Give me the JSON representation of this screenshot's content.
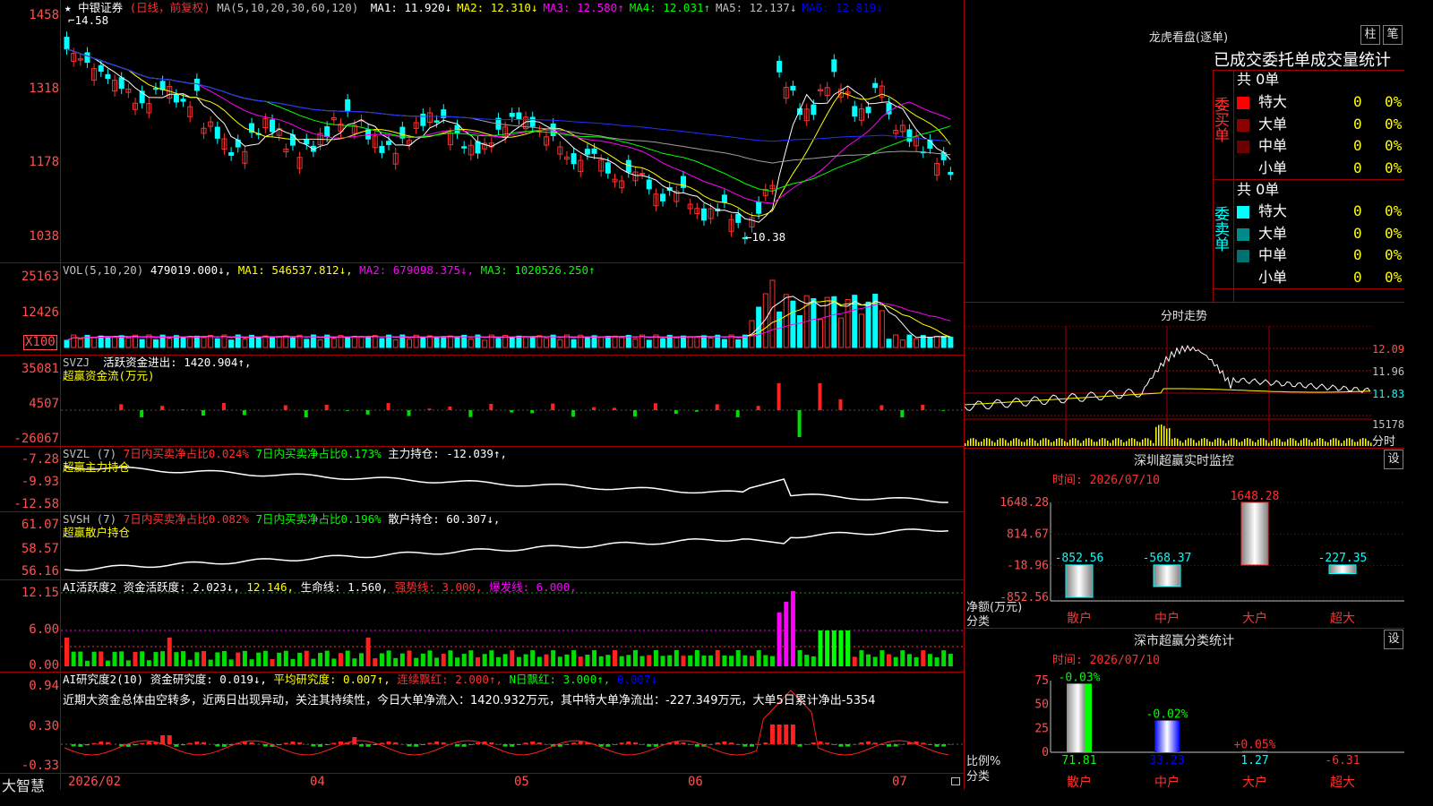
{
  "stock": {
    "name": "中银证券",
    "period": "(日线，前复权)",
    "ma_params": "MA(5,10,20,30,60,120)",
    "ma": [
      {
        "label": "MA1:",
        "value": "11.920",
        "arrow": "↓",
        "color": "#ffffff"
      },
      {
        "label": "MA2:",
        "value": "12.310",
        "arrow": "↓",
        "color": "#ffff00"
      },
      {
        "label": "MA3:",
        "value": "12.580",
        "arrow": "↑",
        "color": "#ff00ff"
      },
      {
        "label": "MA4:",
        "value": "12.031",
        "arrow": "↑",
        "color": "#00ff00"
      },
      {
        "label": "MA5:",
        "value": "12.137",
        "arrow": "↓",
        "color": "#c0c0c0"
      },
      {
        "label": "MA6:",
        "value": "12.819",
        "arrow": "↓",
        "color": "#0000ff"
      }
    ],
    "y_labels": [
      "1458",
      "1318",
      "1178",
      "1038"
    ],
    "high_label": "14.58",
    "low_label": "10.38"
  },
  "vol": {
    "params": "VOL(5,10,20)",
    "value": "479019.000↓,",
    "ma1": "MA1: 546537.812↓,",
    "ma2": "MA2: 679098.375↓,",
    "ma3": "MA3: 1020526.250↑",
    "y_labels": [
      "25163",
      "12426"
    ],
    "unit": "X100"
  },
  "svzj": {
    "name": "SVZJ",
    "desc": "活跃资金进出: 1420.904↑,",
    "sub": "超赢资金流(万元)",
    "y_labels": [
      "35081",
      "4507",
      "-26067"
    ]
  },
  "svzl": {
    "name": "SVZL (7)",
    "a": "7日内买卖净占比0.024%",
    "b": "7日内买卖净占比0.173%",
    "c": "主力持仓: -12.039↑,",
    "sub": "超赢主力持仓",
    "y_labels": [
      "-7.28",
      "-9.93",
      "-12.58"
    ]
  },
  "svsh": {
    "name": "SVSH (7)",
    "a": "7日内买卖净占比0.082%",
    "b": "7日内买卖净占比0.196%",
    "c": "散户持仓: 60.307↓,",
    "sub": "超赢散户持仓",
    "y_labels": [
      "61.07",
      "58.57",
      "56.16"
    ]
  },
  "ai_act": {
    "name": "AI活跃度2",
    "a": "资金活跃度: 2.023↓,",
    "b": "12.146,",
    "c": "生命线: 1.560,",
    "d": "强势线: 3.000,",
    "e": "爆发线: 6.000,",
    "y_labels": [
      "12.15",
      "6.00",
      "0.00"
    ]
  },
  "ai_res": {
    "name": "AI研究度2(10)",
    "a": "资金研究度: 0.019↓,",
    "b": "平均研究度: 0.007↑,",
    "c": "连续飘红: 2.000↑,",
    "d": "N日飘红: 3.000↑,",
    "e": "0.007↓",
    "comment": "近期大资金总体由空转多，近两日出现异动，关注其持续性，今日大单净流入：1420.932万元，其中特大单净流出：-227.349万元，大单5日累计净出-5354",
    "y_labels": [
      "0.94",
      "0.30",
      "-0.33"
    ]
  },
  "x_axis": {
    "app_name": "大智慧",
    "labels": [
      "2026/02",
      "04",
      "05",
      "06",
      "07"
    ]
  },
  "dragon": {
    "title": "龙虎看盘(逐单)",
    "btn1": "柱",
    "btn2": "笔",
    "header": "已成交委托单成交量统计",
    "buy_label": "委买单",
    "sell_label": "委卖单",
    "buy_total": "共 0单",
    "sell_total": "共 0单",
    "buy_rows": [
      {
        "name": "特大",
        "count": "0",
        "pct": "0%",
        "color": "#ff0000"
      },
      {
        "name": "大单",
        "count": "0",
        "pct": "0%",
        "color": "#8b0000"
      },
      {
        "name": "中单",
        "count": "0",
        "pct": "0%",
        "color": "#6b0000"
      },
      {
        "name": "小单",
        "count": "0",
        "pct": "0%",
        "color": ""
      }
    ],
    "sell_rows": [
      {
        "name": "特大",
        "count": "0",
        "pct": "0%",
        "color": "#00ffff"
      },
      {
        "name": "大单",
        "count": "0",
        "pct": "0%",
        "color": "#008b8b"
      },
      {
        "name": "中单",
        "count": "0",
        "pct": "0%",
        "color": "#007070"
      },
      {
        "name": "小单",
        "count": "0",
        "pct": "0%",
        "color": ""
      }
    ]
  },
  "minute": {
    "title": "分时走势",
    "labels": [
      "12.09",
      "11.96",
      "11.83",
      "15178"
    ],
    "unit": "分时"
  },
  "sz_monitor": {
    "title": "深圳超赢实时监控",
    "btn": "设",
    "time": "时间: 2026/07/10",
    "y_labels": [
      "1648.28",
      "814.67",
      "-18.96",
      "-852.56"
    ],
    "axis_title": "净额(万元)",
    "axis_sub": "分类",
    "categories": [
      "散户",
      "中户",
      "大户",
      "超大"
    ],
    "values": [
      -852.56,
      -568.37,
      1648.28,
      -227.35
    ],
    "value_labels": [
      "-852.56",
      "-568.37",
      "1648.28",
      "-227.35"
    ]
  },
  "sz_class": {
    "title": "深市超赢分类统计",
    "btn": "设",
    "time": "时间: 2026/07/10",
    "y_labels": [
      "75",
      "50",
      "25",
      "0"
    ],
    "axis_title": "比例%",
    "axis_sub": "分类",
    "categories": [
      "散户",
      "中户",
      "大户",
      "超大"
    ],
    "values": [
      71.81,
      33.23,
      1.27,
      -6.31
    ],
    "value_labels": [
      "71.81",
      "33.23",
      "1.27",
      "-6.31"
    ],
    "changes": [
      "-0.03%",
      "-0.02%",
      "+0.05%",
      ""
    ]
  }
}
